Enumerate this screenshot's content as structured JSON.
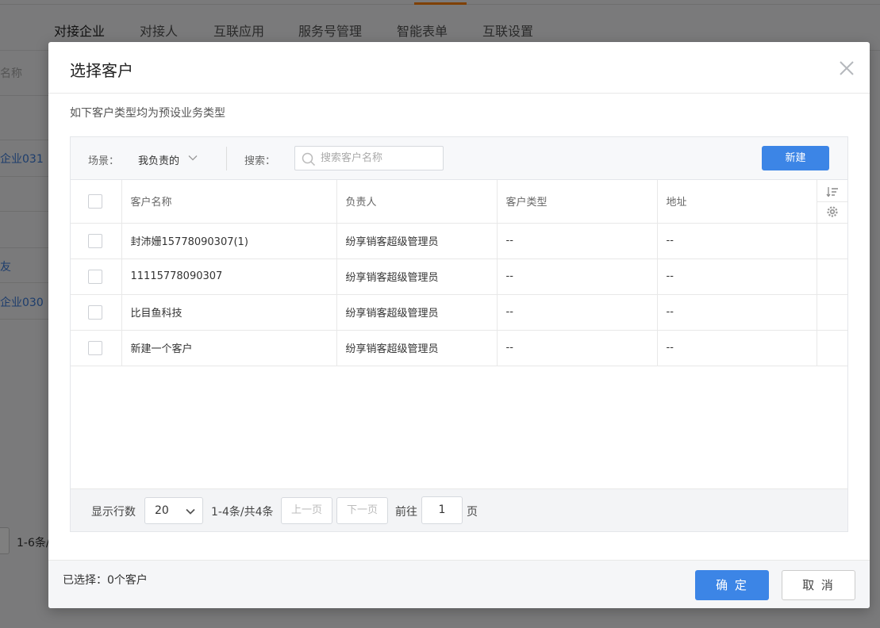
{
  "background": {
    "tabs": [
      "对接企业",
      "对接人",
      "互联应用",
      "服务号管理",
      "智能表单",
      "互联设置"
    ],
    "search_fragment": "名称",
    "links": [
      "企业031",
      "友",
      "企业030"
    ],
    "pager_fragment": "1-6条/"
  },
  "dialog": {
    "title": "选择客户",
    "subtitle": "如下客户类型均为预设业务类型",
    "toolbar": {
      "scene_label": "场景：",
      "scene_value": "我负责的",
      "search_label": "搜索：",
      "search_placeholder": "搜索客户名称",
      "new_label": "新建"
    },
    "table": {
      "columns": [
        "客户名称",
        "负责人",
        "客户类型",
        "地址"
      ],
      "rows": [
        {
          "name": "封沛姗15778090307(1)",
          "owner": "纷享销客超级管理员",
          "type": "--",
          "address": "--"
        },
        {
          "name": "11115778090307",
          "owner": "纷享销客超级管理员",
          "type": "--",
          "address": "--"
        },
        {
          "name": "比目鱼科技",
          "owner": "纷享销客超级管理员",
          "type": "--",
          "address": "--"
        },
        {
          "name": "新建一个客户",
          "owner": "纷享销客超级管理员",
          "type": "--",
          "address": "--"
        }
      ]
    },
    "pager": {
      "rows_label": "显示行数",
      "page_size": "20",
      "range_text": "1-4条/共4条",
      "prev_label": "上一页",
      "next_label": "下一页",
      "goto_label": "前往",
      "page_input": "1",
      "page_suffix": "页"
    },
    "footer": {
      "selected_text": "已选择：0个客户",
      "confirm_label": "确 定",
      "cancel_label": "取 消"
    }
  }
}
